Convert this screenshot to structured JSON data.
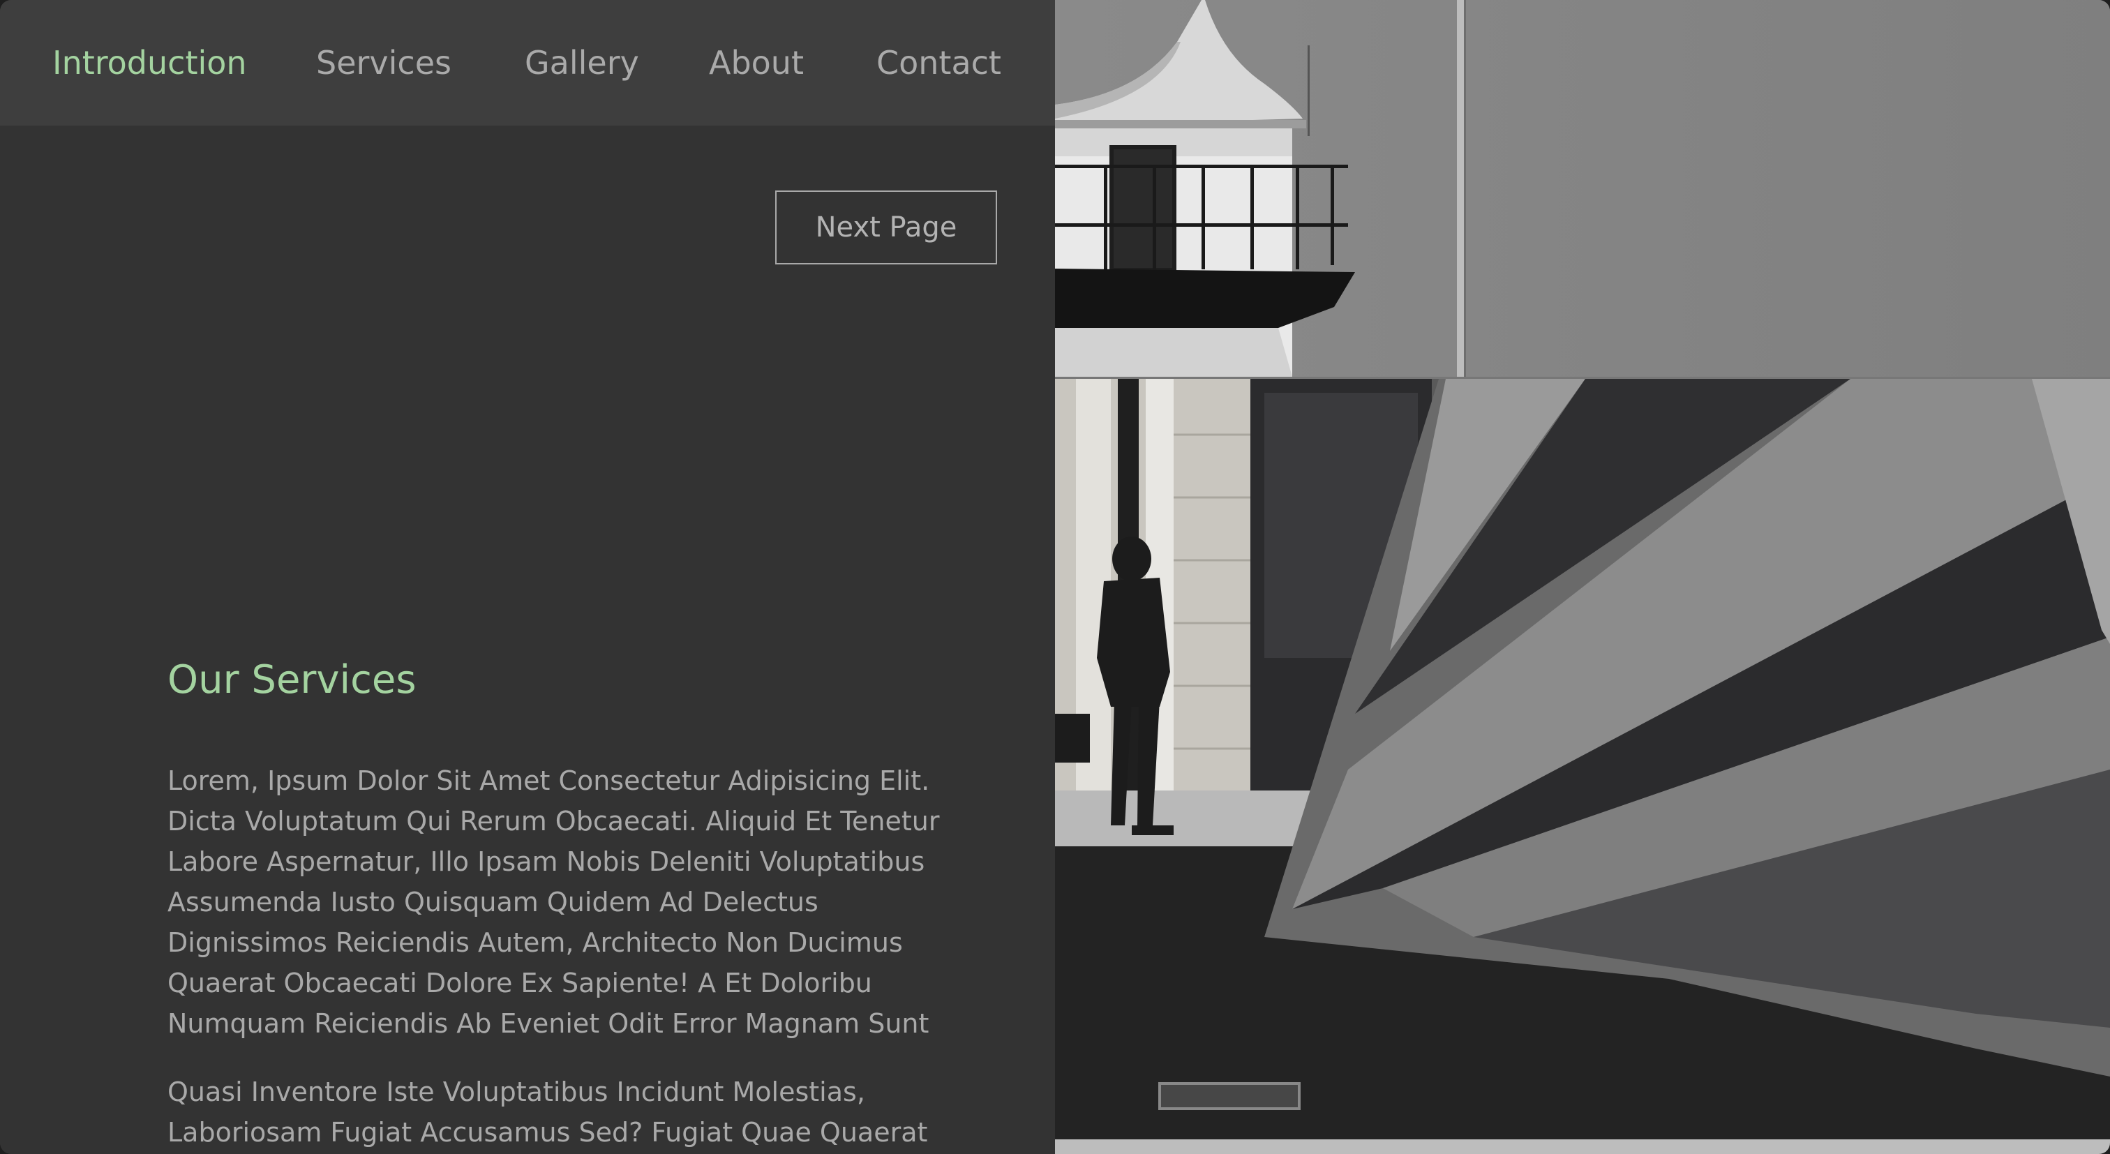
{
  "nav": {
    "items": [
      {
        "label": "Introduction",
        "active": true
      },
      {
        "label": "Services",
        "active": false
      },
      {
        "label": "Gallery",
        "active": false
      },
      {
        "label": "About",
        "active": false
      },
      {
        "label": "Contact",
        "active": false
      }
    ]
  },
  "hero": {
    "next_label": "Next Page"
  },
  "services": {
    "title": "Our Services",
    "paragraph1": [
      "Lorem, Ipsum Dolor Sit Amet Consectetur Adipisicing Elit.",
      "Dicta Voluptatum Qui Rerum Obcaecati. Aliquid Et Tenetur",
      "Labore Aspernatur, Illo Ipsam Nobis Deleniti Voluptatibus",
      "Assumenda Iusto Quisquam Quidem Ad Delectus",
      "Dignissimos Reiciendis Autem, Architecto Non Ducimus",
      "Quaerat Obcaecati Dolore Ex Sapiente! A Et Doloribu",
      "Numquam Reiciendis Ab Eveniet Odit Error Magnam Sunt"
    ],
    "paragraph2": [
      "Quasi Inventore Iste Voluptatibus Incidunt Molestias,",
      "Laboriosam Fugiat Accusamus Sed? Fugiat Quae Quaerat"
    ]
  },
  "colors": {
    "accent": "#a4d3a0",
    "panel": "#333333",
    "nav_bg": "#3e3e3e",
    "text": "#a9a9a9"
  },
  "icons": {
    "photo_top": "lighthouse-photo",
    "photo_bottom": "architecture-photo"
  }
}
